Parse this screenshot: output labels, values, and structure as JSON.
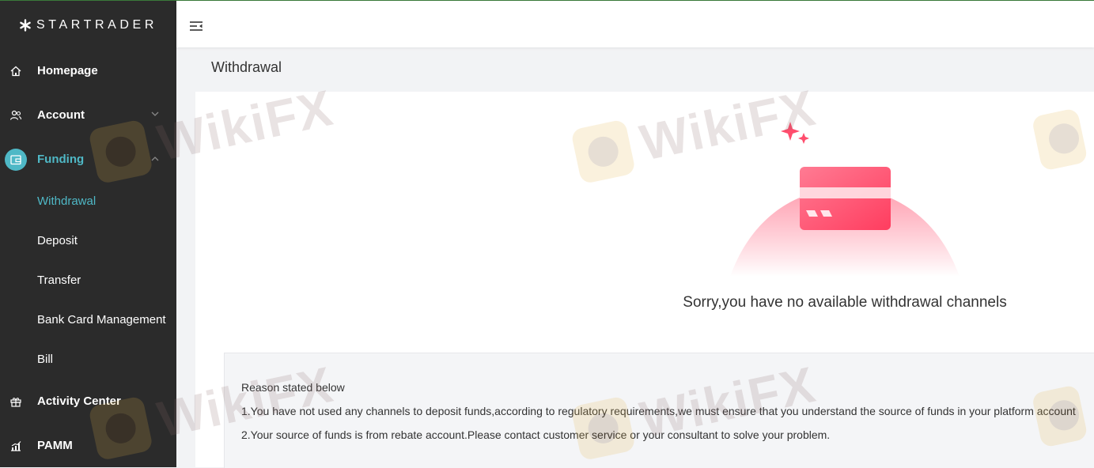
{
  "brand": {
    "name": "STARTRADER"
  },
  "sidebar": {
    "items": [
      {
        "label": "Homepage",
        "icon": "home-icon"
      },
      {
        "label": "Account",
        "icon": "users-icon"
      },
      {
        "label": "Funding",
        "icon": "wallet-icon",
        "active": true
      },
      {
        "label": "Activity Center",
        "icon": "gift-icon"
      },
      {
        "label": "PAMM",
        "icon": "chart-icon"
      }
    ],
    "funding_sub": [
      {
        "label": "Withdrawal",
        "active": true
      },
      {
        "label": "Deposit"
      },
      {
        "label": "Transfer"
      },
      {
        "label": "Bank Card Management"
      },
      {
        "label": "Bill"
      }
    ]
  },
  "main": {
    "title": "Withdrawal",
    "empty_message": "Sorry,you have no available withdrawal channels",
    "reason": {
      "title": "Reason stated below",
      "lines": [
        "1.You have not used any channels to deposit funds,according to regulatory requirements,we must ensure that you understand the source of funds in your platform account",
        "2.Your source of funds is from rebate account.Please contact customer service or your consultant to solve your problem."
      ]
    }
  },
  "watermark": {
    "text": "WikiFX"
  },
  "colors": {
    "accent": "#4fb8c6",
    "sidebar_bg": "#2b2b2b",
    "card_pink": "#ff4d6d"
  }
}
